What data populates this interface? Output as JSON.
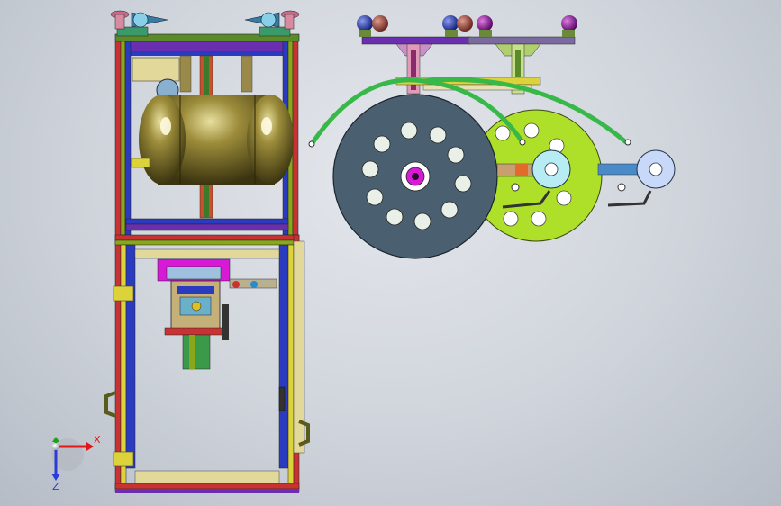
{
  "viewport": {
    "background_top": "#e4e7ec",
    "background_bottom": "#b6bcc6"
  },
  "triad": {
    "x_label": "X",
    "y_label": "Y",
    "z_label": "Z",
    "x_color": "#e01818",
    "y_color": "#19a319",
    "z_color": "#2a3bd8"
  },
  "colors": {
    "frame_green": "#8aa61a",
    "frame_yellow": "#dcd23a",
    "frame_red": "#c83232",
    "frame_blue": "#2b3bc0",
    "frame_purple": "#6a2fb0",
    "tank": "#8a7a2a",
    "disk_grey": "#4a6070",
    "disk_lime": "#aee02a",
    "arc_green": "#39b84a",
    "magenta": "#d61ad6"
  }
}
